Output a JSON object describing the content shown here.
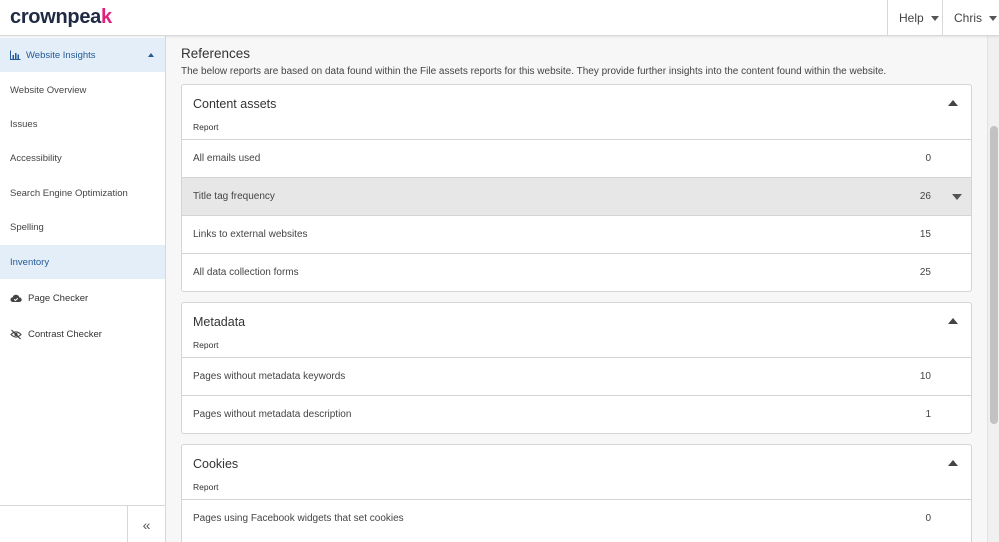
{
  "header": {
    "logo_text_a": "crownpea",
    "logo_text_b": "k",
    "help_label": "Help",
    "user_label": "Chris"
  },
  "sidebar": {
    "section_label": "Website Insights",
    "items": [
      {
        "label": "Website Overview"
      },
      {
        "label": "Issues"
      },
      {
        "label": "Accessibility"
      },
      {
        "label": "Search Engine Optimization"
      },
      {
        "label": "Spelling"
      },
      {
        "label": "Inventory"
      }
    ],
    "tools": [
      {
        "label": "Page Checker"
      },
      {
        "label": "Contrast Checker"
      }
    ],
    "collapse_glyph": "«"
  },
  "main": {
    "heading": "References",
    "description": "The below reports are based on data found within the File assets reports for this website. They provide further insights into the content found within the website.",
    "panels": [
      {
        "title": "Content assets",
        "subheader": "Report",
        "rows": [
          {
            "label": "All emails used",
            "value": "0"
          },
          {
            "label": "Title tag frequency",
            "value": "26"
          },
          {
            "label": "Links to external websites",
            "value": "15"
          },
          {
            "label": "All data collection forms",
            "value": "25"
          }
        ]
      },
      {
        "title": "Metadata",
        "subheader": "Report",
        "rows": [
          {
            "label": "Pages without metadata keywords",
            "value": "10"
          },
          {
            "label": "Pages without metadata description",
            "value": "1"
          }
        ]
      },
      {
        "title": "Cookies",
        "subheader": "Report",
        "rows": [
          {
            "label": "Pages using Facebook widgets that set cookies",
            "value": "0"
          }
        ]
      }
    ]
  },
  "colors": {
    "brand_dark": "#1f2a44",
    "brand_accent": "#e0207a",
    "active_bg": "#e3eef8",
    "active_text": "#245a96"
  }
}
